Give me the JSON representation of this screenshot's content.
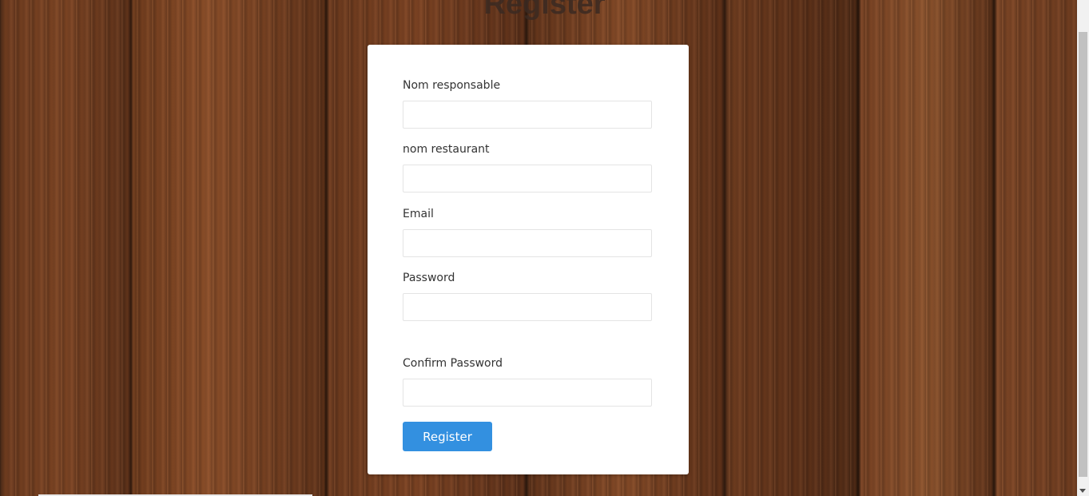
{
  "page": {
    "title": "Register"
  },
  "form": {
    "fields": [
      {
        "label": "Nom responsable",
        "value": "",
        "type": "text"
      },
      {
        "label": "nom restaurant",
        "value": "",
        "type": "text"
      },
      {
        "label": "Email",
        "value": "",
        "type": "email"
      },
      {
        "label": "Password",
        "value": "",
        "type": "password"
      },
      {
        "label": "Confirm Password",
        "value": "",
        "type": "password"
      }
    ],
    "submit_label": "Register"
  },
  "colors": {
    "accent": "#3390e0",
    "card_bg": "#ffffff",
    "label_text": "#333333"
  }
}
